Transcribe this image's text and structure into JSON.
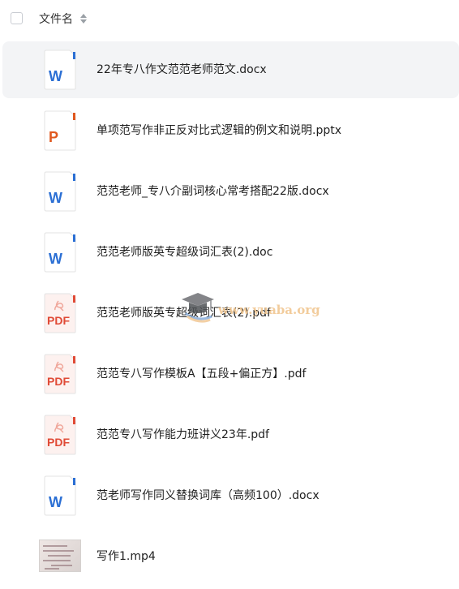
{
  "header": {
    "column_label": "文件名",
    "sort_icon": "sort-icon"
  },
  "files": [
    {
      "name": "22年专八作文范范老师范文.docx",
      "type": "docx",
      "icon": "word-icon",
      "badge": "W",
      "selected": true
    },
    {
      "name": "单项范写作非正反对比式逻辑的例文和说明.pptx",
      "type": "pptx",
      "icon": "powerpoint-icon",
      "badge": "P",
      "selected": false
    },
    {
      "name": "范范老师_专八介副词核心常考搭配22版.docx",
      "type": "docx",
      "icon": "word-icon",
      "badge": "W",
      "selected": false
    },
    {
      "name": "范范老师版英专超级词汇表(2).doc",
      "type": "doc",
      "icon": "word-icon",
      "badge": "W",
      "selected": false
    },
    {
      "name": "范范老师版英专超级词汇表(2).pdf",
      "type": "pdf",
      "icon": "pdf-icon",
      "badge": "PDF",
      "selected": false
    },
    {
      "name": "范范专八写作模板A【五段+偏正方】.pdf",
      "type": "pdf",
      "icon": "pdf-icon",
      "badge": "PDF",
      "selected": false
    },
    {
      "name": "范范专八写作能力班讲义23年.pdf",
      "type": "pdf",
      "icon": "pdf-icon",
      "badge": "PDF",
      "selected": false
    },
    {
      "name": "范老师写作同义替换词库（高频100）.docx",
      "type": "docx",
      "icon": "word-icon",
      "badge": "W",
      "selected": false
    },
    {
      "name": "写作1.mp4",
      "type": "mp4",
      "icon": "video-thumbnail",
      "badge": "",
      "selected": false
    }
  ],
  "watermark": {
    "text": "www.yuaba.org",
    "icon": "graduation-cap-icon"
  },
  "colors": {
    "word_blue": "#2b6fd4",
    "ppt_orange": "#e0581e",
    "pdf_red": "#e04a36",
    "selected_row": "#f3f4f6",
    "icon_paper": "#ffffff",
    "icon_border": "#e3e3e3"
  }
}
